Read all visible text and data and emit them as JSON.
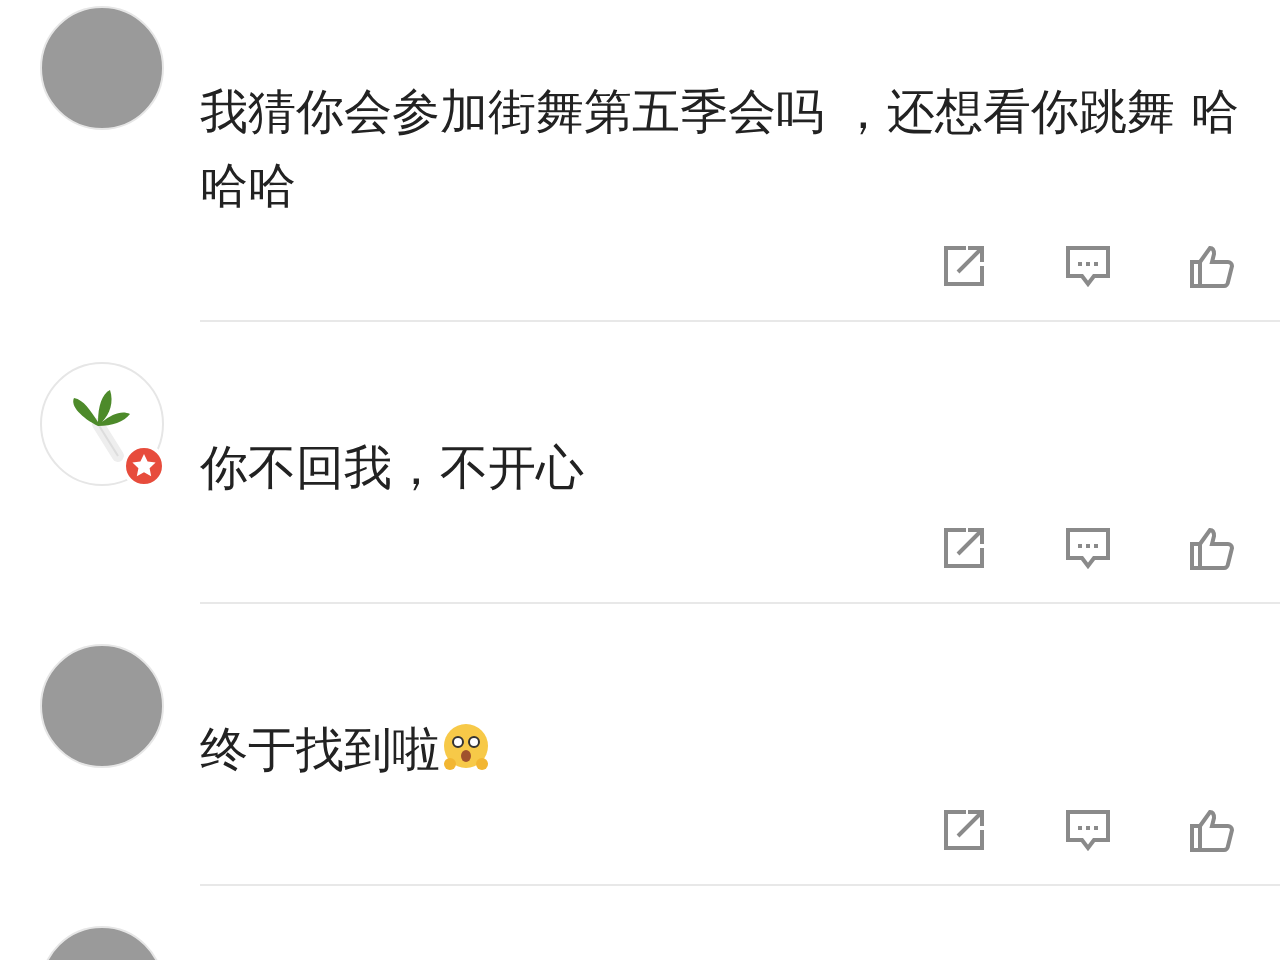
{
  "comments": [
    {
      "kind": "photo",
      "text": "我猜你会参加街舞第五季会吗 ，还想看你跳舞 哈哈哈"
    },
    {
      "kind": "plant",
      "verified": true,
      "text": "你不回我，不开心"
    },
    {
      "kind": "photo",
      "text": "终于找到啦",
      "emoji": true
    },
    {
      "kind": "photo"
    }
  ]
}
